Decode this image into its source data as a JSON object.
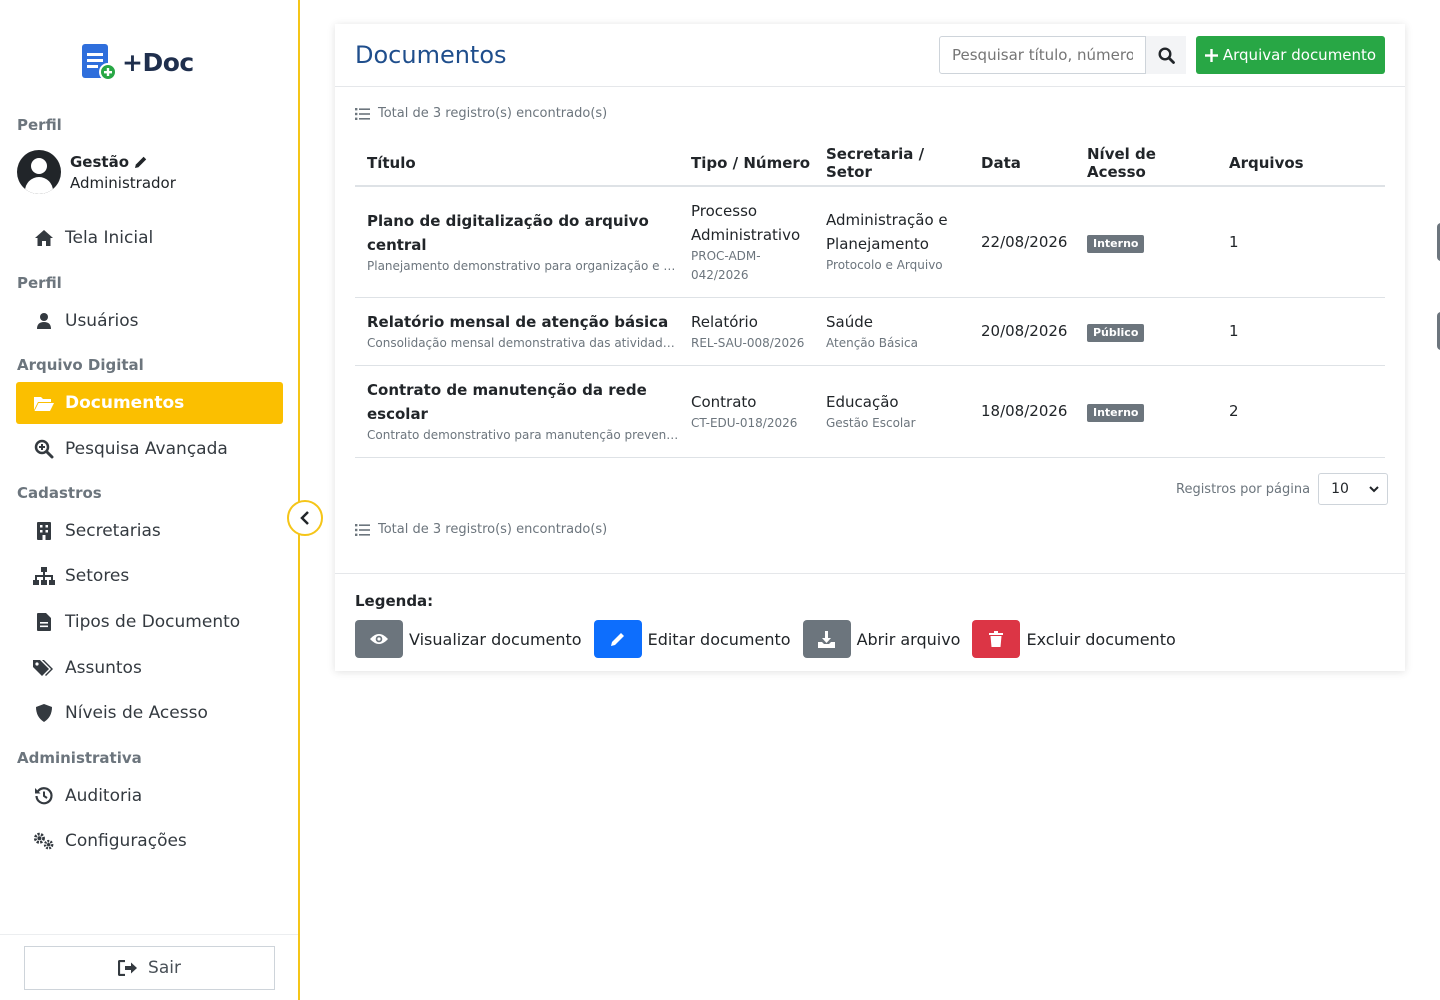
{
  "app": {
    "name": "+Doc"
  },
  "sidebar": {
    "profile_section": "Perfil",
    "user_name": "Gestão",
    "user_role": "Administrador",
    "home": "Tela Inicial",
    "profile_section2": "Perfil",
    "users": "Usuários",
    "archive_section": "Arquivo Digital",
    "documents": "Documentos",
    "advanced_search": "Pesquisa Avançada",
    "registry_section": "Cadastros",
    "departments": "Secretarias",
    "sectors": "Setores",
    "doc_types": "Tipos de Documento",
    "subjects": "Assuntos",
    "access_levels": "Níveis de Acesso",
    "admin_section": "Administrativa",
    "audit": "Auditoria",
    "settings": "Configurações",
    "logout": "Sair"
  },
  "header": {
    "title": "Documentos",
    "search_placeholder": "Pesquisar título, número c",
    "archive_button": "Arquivar documento"
  },
  "total_text": "Total de 3 registro(s) encontrado(s)",
  "table": {
    "columns": [
      "Título",
      "Tipo / Número",
      "Secretaria / Setor",
      "Data",
      "Nível de Acesso",
      "Arquivos"
    ],
    "rows": [
      {
        "title": "Plano de digitalização do arquivo central",
        "desc": "Planejamento demonstrativo para organização e di...",
        "type": "Processo Administrativo",
        "number": "PROC-ADM-042/2026",
        "dept": "Administração e Planejamento",
        "sector": "Protocolo e Arquivo",
        "date": "22/08/2026",
        "access": "Interno",
        "files": "1"
      },
      {
        "title": "Relatório mensal de atenção básica",
        "desc": "Consolidação mensal demonstrativa das atividades ...",
        "type": "Relatório",
        "number": "REL-SAU-008/2026",
        "dept": "Saúde",
        "sector": "Atenção Básica",
        "date": "20/08/2026",
        "access": "Público",
        "files": "1"
      },
      {
        "title": "Contrato de manutenção da rede escolar",
        "desc": "Contrato demonstrativo para manutenção preventi...",
        "type": "Contrato",
        "number": "CT-EDU-018/2026",
        "dept": "Educação",
        "sector": "Gestão Escolar",
        "date": "18/08/2026",
        "access": "Interno",
        "files": "2"
      }
    ]
  },
  "pagination": {
    "per_page_label": "Registros por página",
    "per_page_value": "10"
  },
  "legend": {
    "title": "Legenda:",
    "view": "Visualizar documento",
    "edit": "Editar documento",
    "open": "Abrir arquivo",
    "delete": "Excluir documento"
  },
  "colors": {
    "accent": "#fbbf00",
    "success": "#28a745",
    "primary": "#0d6efd",
    "secondary": "#6c757d",
    "danger": "#dc3545",
    "title": "#1f4e8c"
  }
}
